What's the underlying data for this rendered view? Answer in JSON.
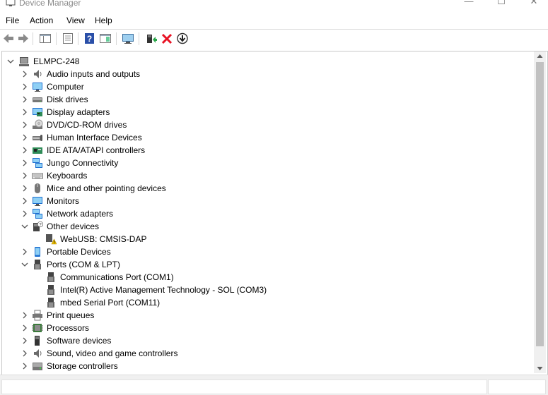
{
  "window": {
    "title": "Device Manager",
    "minimize": "—",
    "maximize": "☐",
    "close": "✕"
  },
  "menu": [
    "File",
    "Action",
    "View",
    "Help"
  ],
  "root": {
    "label": "ELMPC-248"
  },
  "tree": [
    {
      "label": "Audio inputs and outputs",
      "icon": "speaker-icon",
      "expanded": false
    },
    {
      "label": "Computer",
      "icon": "monitor-icon",
      "expanded": false
    },
    {
      "label": "Disk drives",
      "icon": "disk-drive-icon",
      "expanded": false
    },
    {
      "label": "Display adapters",
      "icon": "display-adapter-icon",
      "expanded": false
    },
    {
      "label": "DVD/CD-ROM drives",
      "icon": "dvd-icon",
      "expanded": false
    },
    {
      "label": "Human Interface Devices",
      "icon": "hid-icon",
      "expanded": false
    },
    {
      "label": "IDE ATA/ATAPI controllers",
      "icon": "ide-controller-icon",
      "expanded": false
    },
    {
      "label": "Jungo Connectivity",
      "icon": "network-icon",
      "expanded": false
    },
    {
      "label": "Keyboards",
      "icon": "keyboard-icon",
      "expanded": false
    },
    {
      "label": "Mice and other pointing devices",
      "icon": "mouse-icon",
      "expanded": false
    },
    {
      "label": "Monitors",
      "icon": "monitor-icon",
      "expanded": false
    },
    {
      "label": "Network adapters",
      "icon": "network-icon",
      "expanded": false
    },
    {
      "label": "Other devices",
      "icon": "unknown-device-icon",
      "expanded": true,
      "children": [
        {
          "label": "WebUSB: CMSIS-DAP",
          "icon": "warning-device-icon"
        }
      ]
    },
    {
      "label": "Portable Devices",
      "icon": "portable-device-icon",
      "expanded": false
    },
    {
      "label": "Ports (COM & LPT)",
      "icon": "port-icon",
      "expanded": true,
      "children": [
        {
          "label": "Communications Port (COM1)",
          "icon": "port-icon"
        },
        {
          "label": "Intel(R) Active Management Technology - SOL (COM3)",
          "icon": "port-icon"
        },
        {
          "label": "mbed Serial Port (COM11)",
          "icon": "port-icon"
        }
      ]
    },
    {
      "label": "Print queues",
      "icon": "printer-icon",
      "expanded": false
    },
    {
      "label": "Processors",
      "icon": "processor-icon",
      "expanded": false
    },
    {
      "label": "Software devices",
      "icon": "software-device-icon",
      "expanded": false
    },
    {
      "label": "Sound, video and game controllers",
      "icon": "speaker-icon",
      "expanded": false
    },
    {
      "label": "Storage controllers",
      "icon": "storage-icon",
      "expanded": false
    }
  ],
  "colors": {
    "accent_blue": "#1e6fd0",
    "error_red": "#e81123",
    "warning_yellow": "#f5c400",
    "chevron": "#555555"
  }
}
